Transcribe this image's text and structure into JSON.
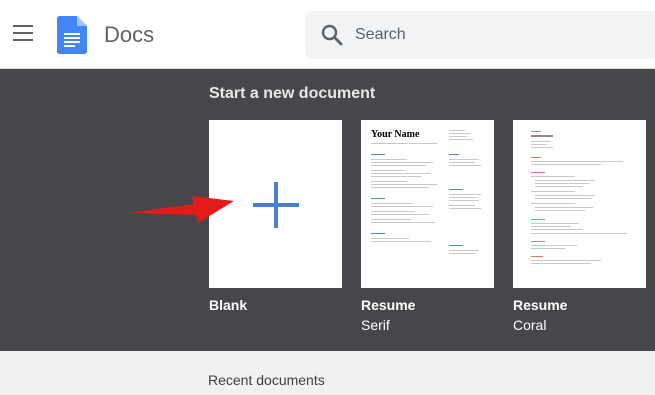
{
  "header": {
    "app_title": "Docs",
    "menu_icon": "hamburger-menu-icon",
    "logo_icon": "google-docs-logo-icon",
    "search": {
      "placeholder": "Search",
      "value": ""
    }
  },
  "gallery": {
    "title": "Start a new document",
    "templates": [
      {
        "label": "Blank",
        "sublabel": ""
      },
      {
        "label": "Resume",
        "sublabel": "Serif",
        "preview_heading": "Your Name"
      },
      {
        "label": "Resume",
        "sublabel": "Coral"
      }
    ]
  },
  "recent": {
    "title": "Recent documents"
  },
  "colors": {
    "accent": "#4a7ece",
    "gallery_bg": "#47474b",
    "arrow": "#e31b1b",
    "coral": "#e07a63",
    "serif_link": "#4a8bd6"
  }
}
